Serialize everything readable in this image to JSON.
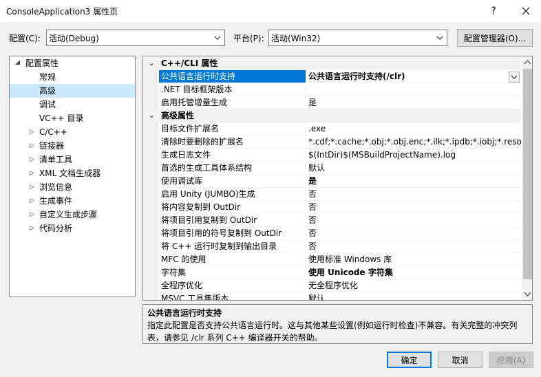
{
  "window": {
    "title": "ConsoleApplication3 属性页",
    "help": "?",
    "close": "✕"
  },
  "config_bar": {
    "config_label": "配置(C):",
    "config_value": "活动(Debug)",
    "platform_label": "平台(P):",
    "platform_value": "活动(Win32)",
    "manager_button": "配置管理器(O)..."
  },
  "tree": {
    "root": "配置属性",
    "items": [
      {
        "label": "常规",
        "expandable": false
      },
      {
        "label": "高级",
        "expandable": false,
        "selected": true
      },
      {
        "label": "调试",
        "expandable": false
      },
      {
        "label": "VC++ 目录",
        "expandable": false
      },
      {
        "label": "C/C++",
        "expandable": true
      },
      {
        "label": "链接器",
        "expandable": true
      },
      {
        "label": "清单工具",
        "expandable": true
      },
      {
        "label": "XML 文档生成器",
        "expandable": true
      },
      {
        "label": "浏览信息",
        "expandable": true
      },
      {
        "label": "生成事件",
        "expandable": true
      },
      {
        "label": "自定义生成步骤",
        "expandable": true
      },
      {
        "label": "代码分析",
        "expandable": true
      }
    ]
  },
  "grid": {
    "categories": [
      {
        "name": "C++/CLI 属性",
        "rows": [
          {
            "name": "公共语言运行时支持",
            "value": "公共语言运行时支持(/clr)",
            "bold": true,
            "selected": true
          },
          {
            "name": ".NET 目标框架版本",
            "value": ""
          },
          {
            "name": "启用托管增量生成",
            "value": "是"
          }
        ]
      },
      {
        "name": "高级属性",
        "rows": [
          {
            "name": "目标文件扩展名",
            "value": ".exe"
          },
          {
            "name": "清除时要删除的扩展名",
            "value": "*.cdf;*.cache;*.obj;*.obj.enc;*.ilk;*.ipdb;*.iobj;*.resources;"
          },
          {
            "name": "生成日志文件",
            "value": "$(IntDir)$(MSBuildProjectName).log"
          },
          {
            "name": "首选的生成工具体系结构",
            "value": "默认"
          },
          {
            "name": "使用调试库",
            "value": "是",
            "bold": true
          },
          {
            "name": "启用 Unity (JUMBO)生成",
            "value": "否"
          },
          {
            "name": "将内容复制到 OutDir",
            "value": "否"
          },
          {
            "name": "将项目引用复制到 OutDir",
            "value": "否"
          },
          {
            "name": "将项目引用的符号复制到 OutDir",
            "value": "否"
          },
          {
            "name": "将 C++ 运行时复制到输出目录",
            "value": "否"
          },
          {
            "name": "MFC 的使用",
            "value": "使用标准 Windows 库"
          },
          {
            "name": "字符集",
            "value": "使用 Unicode 字符集",
            "bold": true
          },
          {
            "name": "全程序优化",
            "value": "无全程序优化"
          },
          {
            "name": "MSVC 工具集版本",
            "value": "默认"
          }
        ]
      }
    ]
  },
  "description": {
    "title": "公共语言运行时支持",
    "text": "指定此配置是否支持公共语言运行时。这与其他某些设置(例如运行时检查)不兼容。有关完整的冲突列表，请参见 /clr 系列 C++ 编译器开关的帮助。"
  },
  "buttons": {
    "ok": "确定",
    "cancel": "取消",
    "apply": "应用(A)"
  }
}
